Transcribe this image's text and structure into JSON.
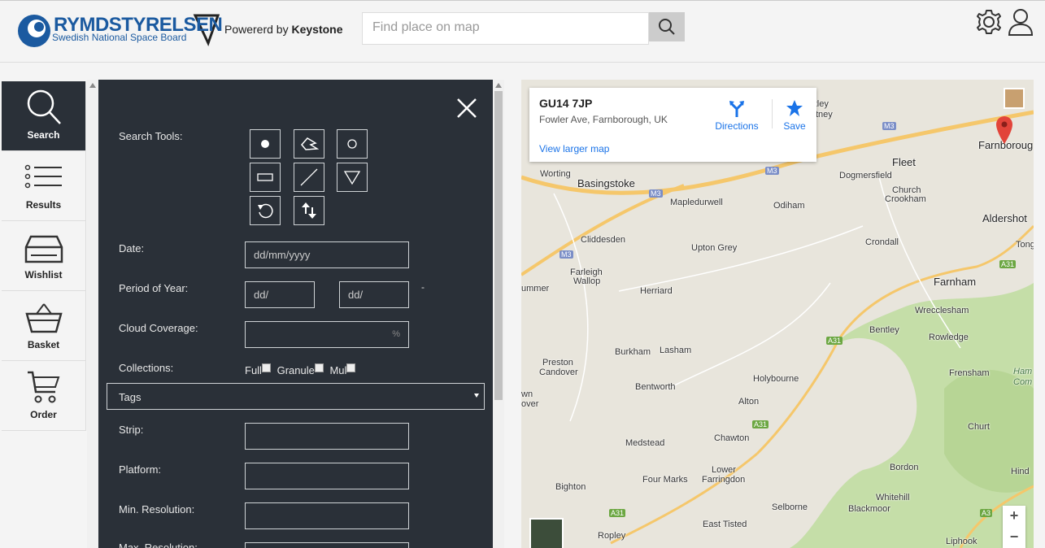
{
  "header": {
    "logo_main": "RYMDSTYRELSEN",
    "logo_sub": "Swedish National Space Board",
    "powered_prefix": "Powererd by ",
    "powered_brand": "Keystone",
    "search_placeholder": "Find place on map"
  },
  "sidebar": {
    "items": [
      {
        "label": "Search",
        "icon": "search-icon",
        "active": true
      },
      {
        "label": "Results",
        "icon": "list-icon"
      },
      {
        "label": "Wishlist",
        "icon": "tray-icon"
      },
      {
        "label": "Basket",
        "icon": "basket-icon"
      },
      {
        "label": "Order",
        "icon": "cart-icon"
      }
    ]
  },
  "panel": {
    "search_tools_label": "Search Tools:",
    "date_label": "Date:",
    "date_placeholder": "dd/mm/yyyy",
    "period_label": "Period of Year:",
    "period_from": "dd/",
    "period_to": "dd/",
    "period_sep": "-",
    "cloud_label": "Cloud Coverage:",
    "cloud_unit": "%",
    "collections_label": "Collections:",
    "collections": [
      "Full",
      "Granule",
      "Mul"
    ],
    "tags_label": "Tags",
    "strip_label": "Strip:",
    "platform_label": "Platform:",
    "min_res_label": "Min. Resolution:",
    "max_res_label": "Max. Resolution:"
  },
  "map": {
    "info": {
      "title": "GU14 7JP",
      "address": "Fowler Ave, Farnborough, UK",
      "view_larger": "View larger map",
      "directions": "Directions",
      "save": "Save"
    },
    "places": {
      "hartley": "Hartley",
      "wintney": "Wintney",
      "fleet": "Fleet",
      "farnborough": "Farnboroug",
      "worting": "Worting",
      "basingstoke": "Basingstoke",
      "mapledurwell": "Mapledurwell",
      "odiham": "Odiham",
      "dogmersfield": "Dogmersfield",
      "church_crookham_1": "Church",
      "church_crookham_2": "Crookham",
      "aldershot": "Aldershot",
      "cliddesden": "Cliddesden",
      "upton_grey": "Upton Grey",
      "crondall": "Crondall",
      "tong": "Tong",
      "farleigh_1": "Farleigh",
      "farleigh_2": "Wallop",
      "herriard": "Herriard",
      "farnham": "Farnham",
      "summer": "ummer",
      "wrecclesham": "Wrecclesham",
      "bentley": "Bentley",
      "rowledge": "Rowledge",
      "preston_1": "Preston",
      "preston_2": "Candover",
      "burkham": "Burkham",
      "lasham": "Lasham",
      "frensham": "Frensham",
      "ham": "Ham",
      "com": "Com",
      "holybourne": "Holybourne",
      "wn": "wn",
      "over": "over",
      "bentworth": "Bentworth",
      "alton": "Alton",
      "churt": "Churt",
      "chawton": "Chawton",
      "medstead": "Medstead",
      "lower_farringdon_1": "Lower",
      "lower_farringdon_2": "Farringdon",
      "bordon": "Bordon",
      "four_marks": "Four Marks",
      "bighton": "Bighton",
      "hind": "Hind",
      "whitehill": "Whitehill",
      "selborne": "Selborne",
      "blackmoor": "Blackmoor",
      "east_tisted": "East Tisted",
      "ropley": "Ropley",
      "liphook": "Liphook"
    },
    "roads": {
      "m3_a": "M3",
      "m3_b": "M3",
      "m3_c": "M3",
      "m3_d": "M3",
      "a31_a": "A31",
      "a31_b": "A31",
      "a31_c": "A31",
      "a31_d": "A31",
      "a31_e": "A31",
      "a3": "A3"
    },
    "zoom_in": "+",
    "zoom_out": "−",
    "colors": {
      "land": "#e8e5dc",
      "green": "#c5dea8",
      "motorway": "#f5c76b",
      "pin": "#e2443a"
    }
  }
}
